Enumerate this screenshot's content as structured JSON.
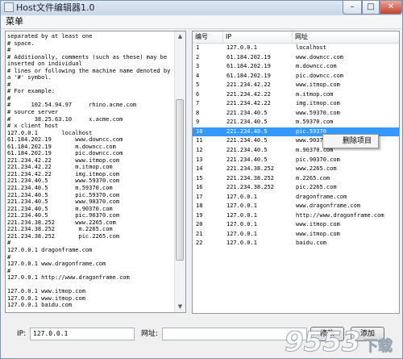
{
  "window": {
    "title": "Host文件编辑器1.0",
    "controls": {
      "minimize": "–",
      "maximize": "□",
      "close": "✕"
    }
  },
  "menu": {
    "items": [
      "菜单"
    ]
  },
  "editor": {
    "scroll": {
      "up": "▲",
      "down": "▼"
    },
    "text": "separated by at least one\n# space.\n#\n# Additionally, comments (such as these) may be\ninserted on individual\n# lines or following the machine name denoted by\na '#' symbol.\n#\n# For example:\n#\n#      102.54.94.97     rhino.acme.com\n# source server\n#       38.25.63.10     x.acme.com\n# x client host\n127.0.0.1       localhost\n61.184.202.19       www.downcc.com\n61.184.202.19       m.downcc.com\n61.184.202.19       pic.downcc.com\n221.234.42.22       www.itmop.com\n221.234.42.22       m.itmop.com\n221.234.42.22       img.itmop.com\n221.234.40.5        www.59370.com\n221.234.40.5        m.59370.com\n221.234.40.5        pic.59370.com\n221.234.40.5        www.90370.com\n221.234.40.5        m.90370.com\n221.234.40.5        pic.90370.com\n221.234.38.252      www.2265.com\n221.234.38.252       m.2265.com\n221.234.38.252       pic.2265.com\n#\n127.0.0.1 dragonframe.com\n#\n127.0.0.1 www.dragonframe.com\n#\n127.0.0.1 http://www.dragonframe.com\n\n127.0.0.1 www.itmop.com\n127.0.0.1 www.itmop.com\n127.0.0.1 baidu.com"
  },
  "table": {
    "columns": [
      "编号",
      "IP",
      "网址"
    ],
    "selected_index": 9,
    "rows": [
      [
        "1",
        "127.0.0.1",
        "localhost"
      ],
      [
        "2",
        "61.184.202.19",
        "www.downcc.com"
      ],
      [
        "3",
        "61.184.202.19",
        "m.downcc.com"
      ],
      [
        "4",
        "61.184.202.19",
        "pic.downcc.com"
      ],
      [
        "5",
        "221.234.42.22",
        "www.itmop.com"
      ],
      [
        "6",
        "221.234.42.22",
        "m.itmop.com"
      ],
      [
        "7",
        "221.234.42.22",
        "img.itmop.com"
      ],
      [
        "8",
        "221.234.40.5",
        "www.59370.com"
      ],
      [
        "9",
        "221.234.40.5",
        "m.59370.com"
      ],
      [
        "10",
        "221.234.40.5",
        "pic.59370"
      ],
      [
        "11",
        "221.234.40.5",
        "www.9037"
      ],
      [
        "12",
        "221.234.40.5",
        "m.90370.com"
      ],
      [
        "13",
        "221.234.40.5",
        "pic.90370.com"
      ],
      [
        "14",
        "221.234.38.252",
        "www.2265.com"
      ],
      [
        "15",
        "221.234.38.252",
        "m.2265.com"
      ],
      [
        "16",
        "221.234.38.252",
        "pic.2265.com"
      ],
      [
        "17",
        "127.0.0.1",
        "dragonframe.com"
      ],
      [
        "18",
        "127.0.0.1",
        "www.dragonframe.com"
      ],
      [
        "19",
        "127.0.0.1",
        "http://www.dragonframe.com"
      ],
      [
        "20",
        "127.0.0.1",
        "www.itmop.com"
      ],
      [
        "21",
        "127.0.0.1",
        "www.itmop.com"
      ],
      [
        "22",
        "127.0.0.1",
        "baidu.com"
      ]
    ]
  },
  "context_menu": {
    "delete_label": "删除项目"
  },
  "form": {
    "ip_label": "IP:",
    "ip_value": "127.0.0.1",
    "url_label": "网址:",
    "url_value": "",
    "modify_label": "修改",
    "add_label": "添加"
  },
  "watermark": {
    "text": "9553",
    "sub": "下载"
  },
  "colors": {
    "selection": "#3399ff",
    "window_bg": "#f0f0f0"
  }
}
